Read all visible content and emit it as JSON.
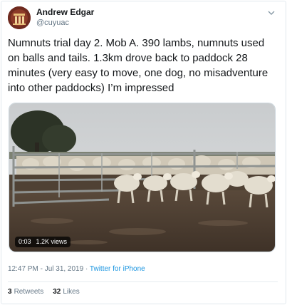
{
  "author": {
    "name": "Andrew Edgar",
    "handle": "@cuyuac"
  },
  "tweet": {
    "text": "Numnuts trial day 2. Mob A. 390 lambs, numnuts used on balls and tails. 1.3km drove back to paddock 28 minutes (very easy to move, one dog, no misadventure into other paddocks) I’m impressed"
  },
  "media": {
    "type": "video",
    "duration": "0:03",
    "views": "1.2K views"
  },
  "meta": {
    "timestamp": "12:47 PM - Jul 31, 2019",
    "separator": "·",
    "source": "Twitter for iPhone"
  },
  "stats": {
    "retweets_count": "3",
    "retweets_label": "Retweets",
    "likes_count": "32",
    "likes_label": "Likes"
  },
  "icons": {
    "caret": "chevron-down-icon",
    "avatar": "avatar"
  },
  "colors": {
    "link": "#1b95e0",
    "secondary_text": "#657786",
    "primary_text": "#14171a",
    "border": "#e1e8ed"
  }
}
